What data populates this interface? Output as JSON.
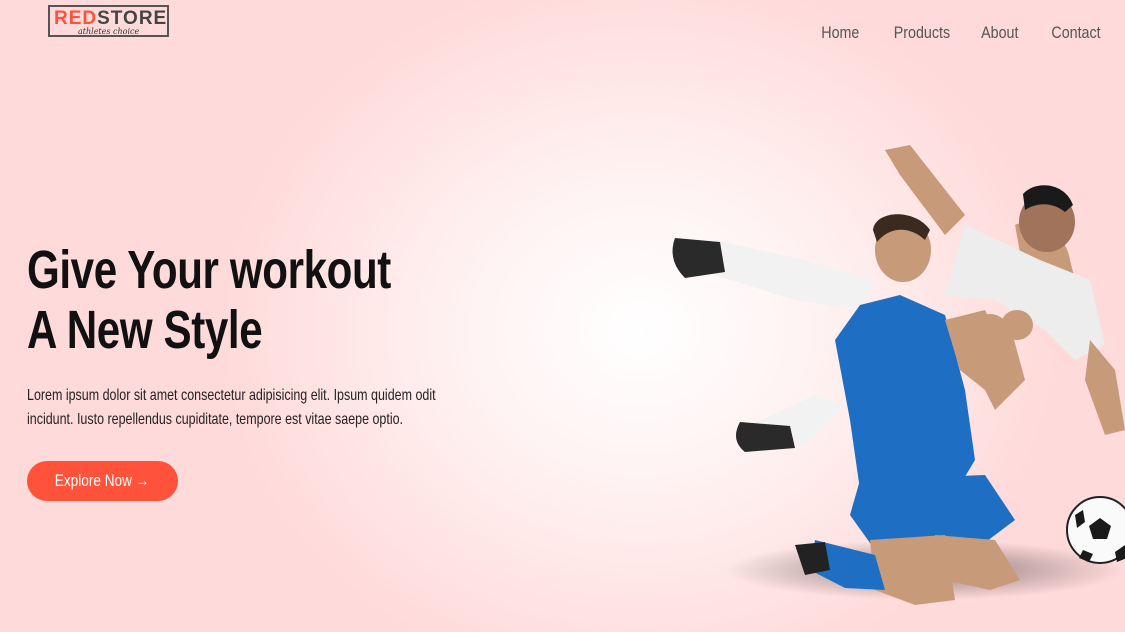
{
  "brand": {
    "name_red": "RED",
    "name_dark": "STORE",
    "tagline": "athletes choice"
  },
  "nav": {
    "items": [
      {
        "label": "Home"
      },
      {
        "label": "Products"
      },
      {
        "label": "About"
      },
      {
        "label": "Contact"
      }
    ]
  },
  "hero": {
    "title_line1": "Give Your workout",
    "title_line2": "A New Style",
    "description": "Lorem ipsum dolor sit amet consectetur adipisicing elit. Ipsum quidem odit incidunt. Iusto repellendus cupiditate, tempore est vitae saepe optio.",
    "cta_label": "Explore Now →"
  },
  "colors": {
    "accent": "#ff523b",
    "text": "#111111",
    "background": "#ffdada"
  },
  "icons": {
    "hero_image": "soccer-players-image"
  }
}
